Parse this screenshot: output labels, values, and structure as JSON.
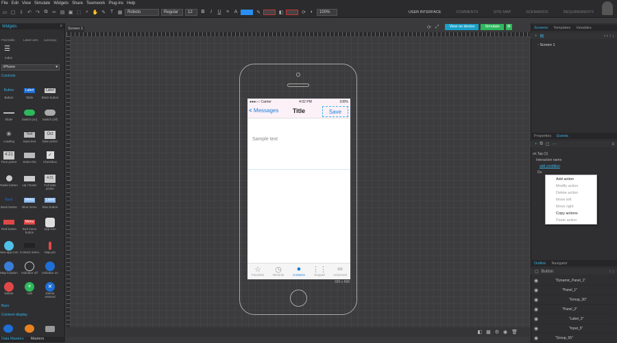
{
  "menubar": [
    "File",
    "Edit",
    "View",
    "Simulate",
    "Widgets",
    "Share",
    "Teamwork",
    "Plug-ins",
    "Help"
  ],
  "toolbar": {
    "font": "Roboto",
    "weight": "Regular",
    "size": "12",
    "zoom": "100%"
  },
  "modes": [
    "USER INTERFACE",
    "COMMENTS",
    "SITE MAP",
    "SCENARIOS",
    "REQUIREMENTS"
  ],
  "left_panel": {
    "header": "Widgets",
    "top_labels": [
      "Find table",
      "Label units",
      "summary"
    ],
    "index_label": "Index",
    "device": "iPhone",
    "section_controls": "Controls",
    "widgets": [
      {
        "label": "Button",
        "glyph": "Button"
      },
      {
        "label": "Table",
        "glyph": "Label"
      },
      {
        "label": "Black button",
        "glyph": "Label"
      },
      {
        "label": "Slider",
        "glyph": ""
      },
      {
        "label": "Switch (on)",
        "glyph": ""
      },
      {
        "label": "Switch (off)",
        "glyph": ""
      },
      {
        "label": "Loading",
        "glyph": "✳"
      },
      {
        "label": "Input text",
        "glyph": "Text"
      },
      {
        "label": "Date picker",
        "glyph": "Oct"
      },
      {
        "label": "Time picker",
        "glyph": "4:21"
      },
      {
        "label": "Select list",
        "glyph": ""
      },
      {
        "label": "Checkbox",
        "glyph": "✓"
      },
      {
        "label": "Radio button",
        "glyph": ""
      },
      {
        "label": "Up / Down",
        "glyph": ""
      },
      {
        "label": "Full date picker",
        "glyph": "4:21"
      },
      {
        "label": "Back button",
        "glyph": "Back"
      },
      {
        "label": "Blue menu",
        "glyph": "Menu"
      },
      {
        "label": "Blue button",
        "glyph": "Label"
      },
      {
        "label": "Red button",
        "glyph": ""
      },
      {
        "label": "Red menu button",
        "glyph": "Menu"
      },
      {
        "label": "App icon",
        "glyph": ""
      },
      {
        "label": "New app icon",
        "glyph": ""
      },
      {
        "label": "Context menu",
        "glyph": ""
      },
      {
        "label": "Map pin",
        "glyph": ""
      },
      {
        "label": "Map location",
        "glyph": ""
      },
      {
        "label": "Indicator off",
        "glyph": ""
      },
      {
        "label": "Indicator on",
        "glyph": ""
      },
      {
        "label": "Delete",
        "glyph": ""
      },
      {
        "label": "Add",
        "glyph": "+"
      },
      {
        "label": "Delete entered",
        "glyph": "✕"
      }
    ],
    "section_bars": "Bars",
    "section_content": "Content display",
    "bottom_tabs": [
      "Data Masters",
      "Masters"
    ]
  },
  "canvas": {
    "tab": "Screen 1",
    "size_label": "320 x 568"
  },
  "top_buttons": {
    "view_on_device": "View on device",
    "simulate": "Simulate"
  },
  "phone": {
    "status_carrier": "●●●○○ Carrier",
    "status_time": "4:02 PM",
    "status_battery": "100%",
    "back": "Messages",
    "title": "Title",
    "save": "Save",
    "sample_text": "Sample text",
    "tabs": [
      {
        "label": "Favorites",
        "icon": "☆"
      },
      {
        "label": "Recents",
        "icon": "◷"
      },
      {
        "label": "Contacts",
        "icon": "●"
      },
      {
        "label": "Keypad",
        "icon": "⋮⋮"
      },
      {
        "label": "Voicemail",
        "icon": "∞"
      }
    ]
  },
  "right_panel": {
    "tabs": [
      "Screens",
      "Templates",
      "Variables"
    ],
    "screen_item": "Screen 1",
    "prop_tabs": [
      "Properties",
      "Events"
    ],
    "on_tap": "on Tap (1)",
    "interaction_name": "Interaction name",
    "add_condition": "add condition",
    "do_label": "Do",
    "context_menu": [
      {
        "label": "Add action",
        "enabled": true
      },
      {
        "label": "Modify action",
        "enabled": false
      },
      {
        "label": "Delete action",
        "enabled": false
      },
      {
        "label": "Move left",
        "enabled": false
      },
      {
        "label": "Move right",
        "enabled": false
      },
      {
        "label": "Copy actions",
        "enabled": true
      },
      {
        "label": "Paste action",
        "enabled": false
      }
    ],
    "outline_tabs": [
      "Outline",
      "Navigator"
    ],
    "outline_root": "Button",
    "outline_rows": [
      "\"Dynamic_Panel_1\"",
      "\"Panel_1\"",
      "\"Group_30\"",
      "\"Panel_2\"",
      "\"Label_3\"",
      "\"Input_5\"",
      "\"Group_55\""
    ]
  }
}
